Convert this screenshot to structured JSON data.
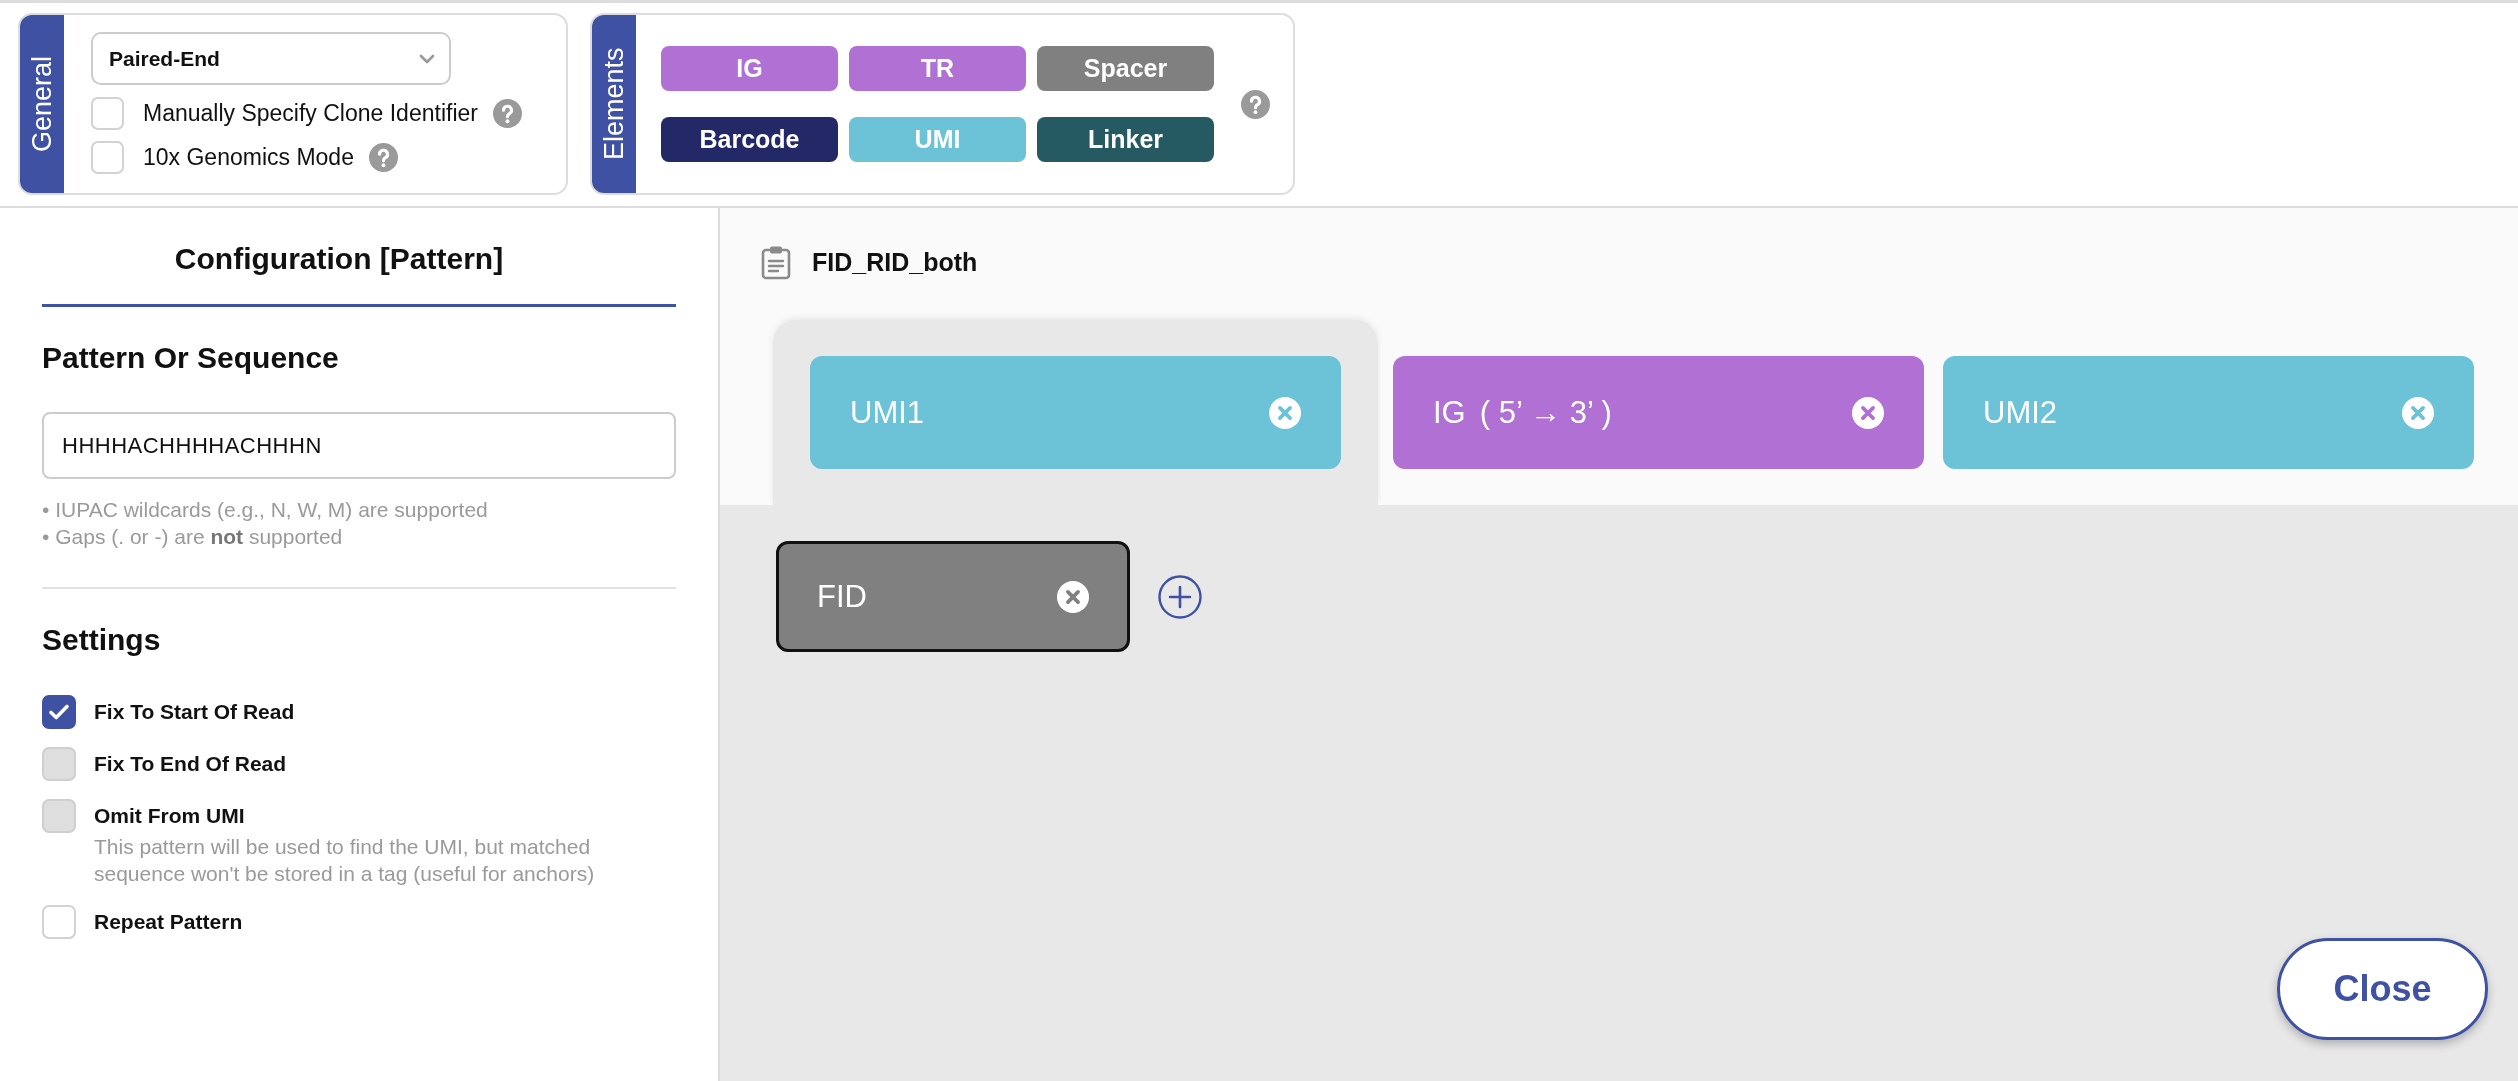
{
  "general": {
    "title": "General",
    "read_mode": {
      "value": "Paired-End"
    },
    "options": [
      {
        "label": "Manually Specify Clone Identifier",
        "checked": false
      },
      {
        "label": "10x Genomics Mode",
        "checked": false
      }
    ]
  },
  "elements": {
    "title": "Elements",
    "items": [
      {
        "label": "IG",
        "color": "#b070d4"
      },
      {
        "label": "TR",
        "color": "#b070d4"
      },
      {
        "label": "Spacer",
        "color": "#808080"
      },
      {
        "label": "Barcode",
        "color": "#222966"
      },
      {
        "label": "UMI",
        "color": "#6cc2d7"
      },
      {
        "label": "Linker",
        "color": "#255a62"
      }
    ]
  },
  "config": {
    "title": "Configuration [Pattern]",
    "pattern": {
      "heading": "Pattern Or Sequence",
      "value": "HHHHACHHHHACHHHN",
      "hints": [
        "• IUPAC wildcards (e.g., N, W, M) are supported",
        "• Gaps (. or -) are **not** supported"
      ]
    },
    "settings": {
      "heading": "Settings",
      "items": [
        {
          "label": "Fix To Start Of Read",
          "checked": true,
          "disabled": false
        },
        {
          "label": "Fix To End Of Read",
          "checked": false,
          "disabled": true
        },
        {
          "label": "Omit From UMI",
          "checked": false,
          "disabled": true,
          "description": "This pattern will be used to find the UMI, but matched sequence won't be stored in a tag (useful for anchors)"
        },
        {
          "label": "Repeat Pattern",
          "checked": false,
          "disabled": false
        }
      ]
    }
  },
  "editor": {
    "title": "FID_RID_both",
    "segments": [
      {
        "label": "UMI1",
        "color": "#6cc2d7",
        "selected": true
      },
      {
        "label": "IG",
        "orientation": "( 5’ → 3’ )",
        "color": "#b070d4",
        "selected": false
      },
      {
        "label": "UMI2",
        "color": "#6cc2d7",
        "selected": false
      }
    ],
    "patterns": [
      {
        "label": "FID",
        "color": "#808080",
        "selected": true
      }
    ]
  },
  "close_button": {
    "label": "Close"
  }
}
